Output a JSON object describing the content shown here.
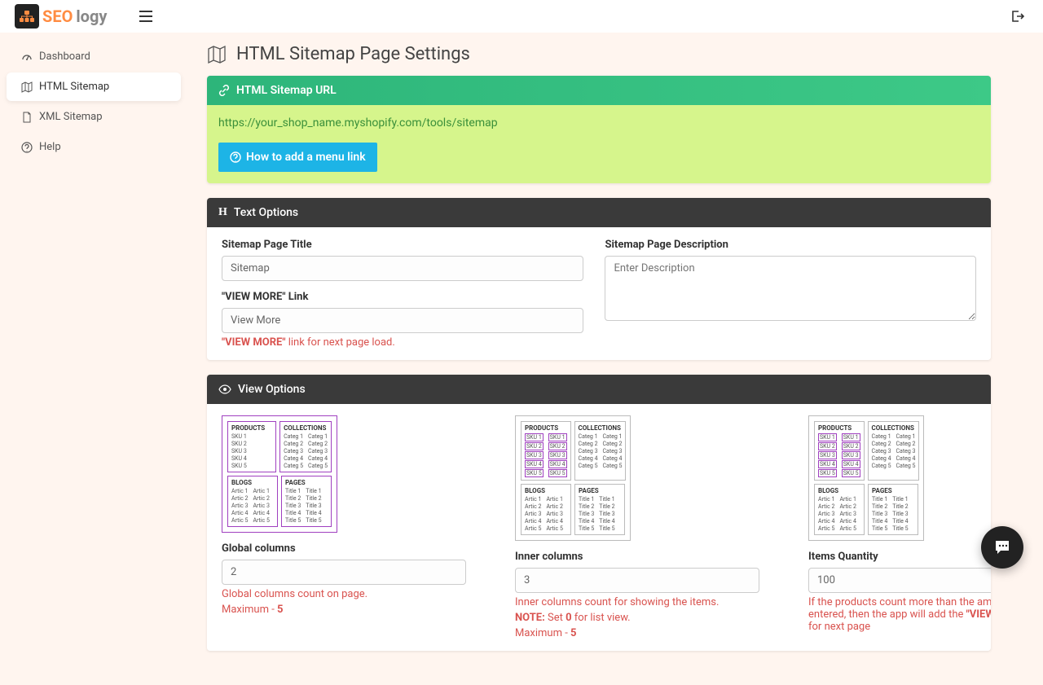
{
  "brand": {
    "seo": "SEO",
    "logy": "logy"
  },
  "nav": {
    "dashboard": "Dashboard",
    "html_sitemap": "HTML Sitemap",
    "xml_sitemap": "XML Sitemap",
    "help": "Help"
  },
  "page": {
    "title": "HTML Sitemap Page Settings"
  },
  "url_card": {
    "heading": "HTML Sitemap URL",
    "url": "https://your_shop_name.myshopify.com/tools/sitemap",
    "button": "How to add a menu link"
  },
  "text_options": {
    "heading": "Text Options",
    "title_label": "Sitemap Page Title",
    "title_value": "Sitemap",
    "desc_label": "Sitemap Page Description",
    "desc_placeholder": "Enter Description",
    "viewmore_label": "\"VIEW MORE\" Link",
    "viewmore_value": "View More",
    "viewmore_hint_bold": "\"VIEW MORE\"",
    "viewmore_hint_rest": " link for next page load."
  },
  "view_options": {
    "heading": "View Options",
    "global": {
      "label": "Global columns",
      "value": "2",
      "hint1": "Global columns count on page.",
      "hint2_pre": "Maximum - ",
      "hint2_bold": "5"
    },
    "inner": {
      "label": "Inner columns",
      "value": "3",
      "hint1": "Inner columns count for showing the items.",
      "note_label": "NOTE: ",
      "note_mid": "Set ",
      "note_bold": "0",
      "note_rest": " for list view.",
      "hint3_pre": "Maximum - ",
      "hint3_bold": "5"
    },
    "items": {
      "label": "Items Quantity",
      "value": "100",
      "hint1": "If the products count more than the amount you entered, then the app will add the ",
      "hint1_bold": "\"VIEW MORE\"",
      "hint1_rest": " link for next page"
    }
  },
  "diagram": {
    "products": "PRODUCTS",
    "collections": "COLLECTIONS",
    "blogs": "BLOGS",
    "pages": "PAGES",
    "sku": [
      "SKU 1",
      "SKU 2",
      "SKU 3",
      "SKU 4",
      "SKU 5"
    ],
    "categ": [
      "Categ 1",
      "Categ 2",
      "Categ 3",
      "Categ 4",
      "Categ 5"
    ],
    "artic": [
      "Artic 1",
      "Artic 2",
      "Artic 3",
      "Artic 4",
      "Artic 5"
    ],
    "title": [
      "Title 1",
      "Title 2",
      "Title 3",
      "Title 4",
      "Title 5"
    ]
  }
}
